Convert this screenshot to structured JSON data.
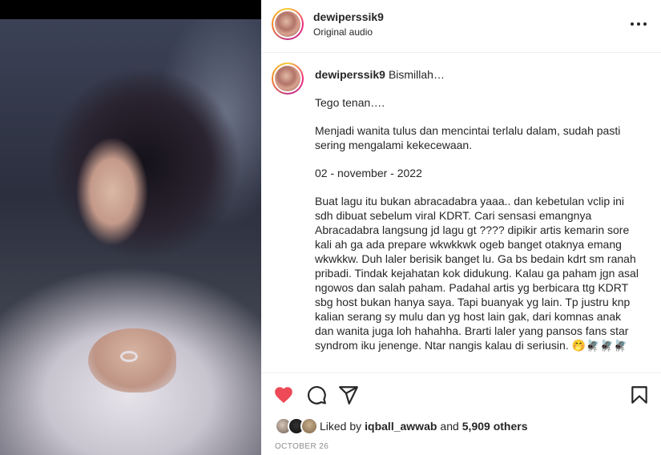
{
  "header": {
    "username": "dewiperssik9",
    "subtitle": "Original audio"
  },
  "caption": {
    "username": "dewiperssik9",
    "first_line": "Bismillah…",
    "paragraphs": [
      "Tego tenan….",
      "Menjadi wanita tulus dan mencintai terlalu dalam, sudah pasti sering mengalami kekecewaan.",
      "02 - november - 2022",
      "Buat lagu itu bukan abracadabra yaaa.. dan kebetulan vclip ini sdh dibuat sebelum viral KDRT. Cari sensasi emangnya Abracadabra langsung jd lagu gt ???? dipikir artis kemarin sore kali ah ga ada prepare wkwkkwk ogeb banget otaknya emang wkwkkw. Duh laler berisik banget lu. Ga bs bedain kdrt sm ranah pribadi. Tindak kejahatan kok didukung. Kalau ga paham jgn asal ngowos dan salah paham. Padahal artis yg berbicara ttg KDRT sbg host bukan hanya saya. Tapi buanyak yg lain. Tp justru knp kalian serang sy mulu dan yg host lain gak, dari komnas anak dan wanita juga loh hahahha. Brarti laler yang pansos fans star syndrom iku jenenge. Ntar nangis kalau di seriusin."
    ],
    "trailing_emoji": "🤭🪰🪰🪰"
  },
  "actions": {
    "like_icon": "heart-filled-icon",
    "comment_icon": "comment-icon",
    "share_icon": "send-icon",
    "save_icon": "bookmark-icon",
    "like_color": "#ed4956"
  },
  "likes": {
    "prefix": "Liked by",
    "user": "iqball_awwab",
    "conjunction": "and",
    "count": "5,909 others"
  },
  "date": "OCTOBER 26"
}
